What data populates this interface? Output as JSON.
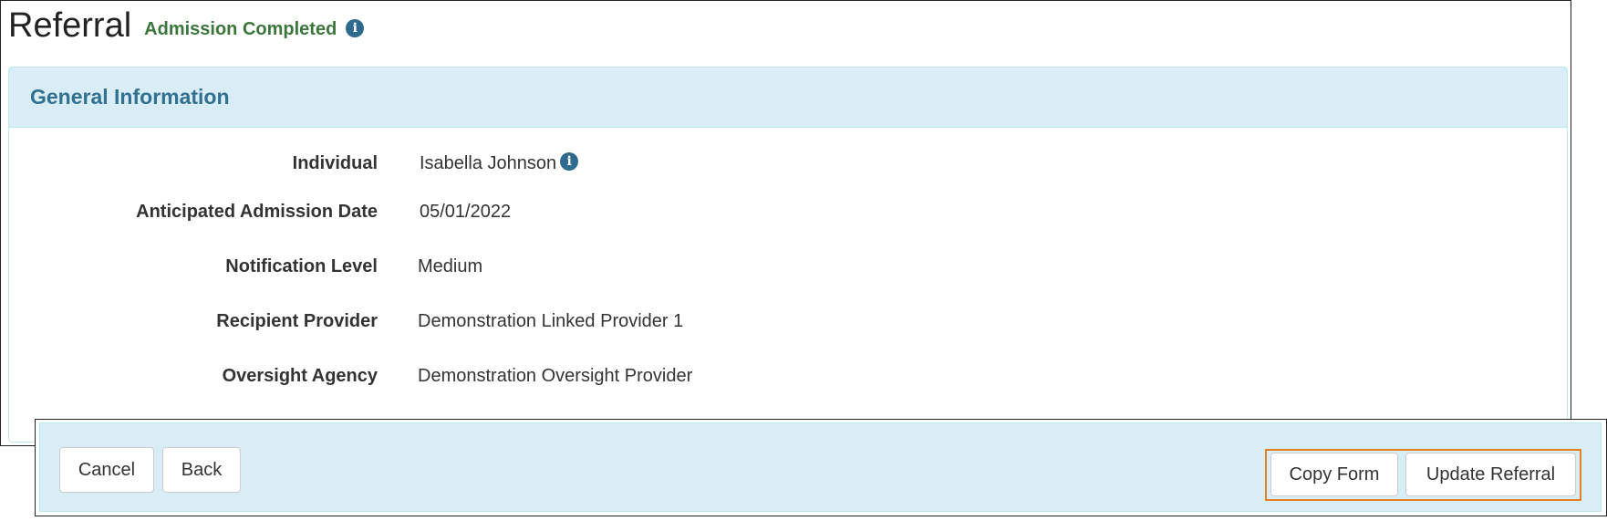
{
  "header": {
    "title": "Referral",
    "status": "Admission Completed",
    "status_info_icon": "info-circle-icon"
  },
  "panel": {
    "title": "General Information",
    "fields": [
      {
        "label": "Individual",
        "value": "Isabella Johnson",
        "icon": "info-circle-icon"
      },
      {
        "label": "Anticipated Admission Date",
        "value": "05/01/2022"
      },
      {
        "label": "Notification Level",
        "value": "Medium"
      },
      {
        "label": "Recipient Provider",
        "value": "Demonstration Linked Provider 1"
      },
      {
        "label": "Oversight Agency",
        "value": "Demonstration Oversight Provider"
      }
    ]
  },
  "footer": {
    "cancel_label": "Cancel",
    "back_label": "Back",
    "copy_label": "Copy Form",
    "update_label": "Update Referral"
  },
  "colors": {
    "status": "#3c763d",
    "panel_bg": "#d9edf7",
    "panel_title": "#31708f",
    "info_icon": "#2e6a8e",
    "highlight": "#e67e22"
  }
}
